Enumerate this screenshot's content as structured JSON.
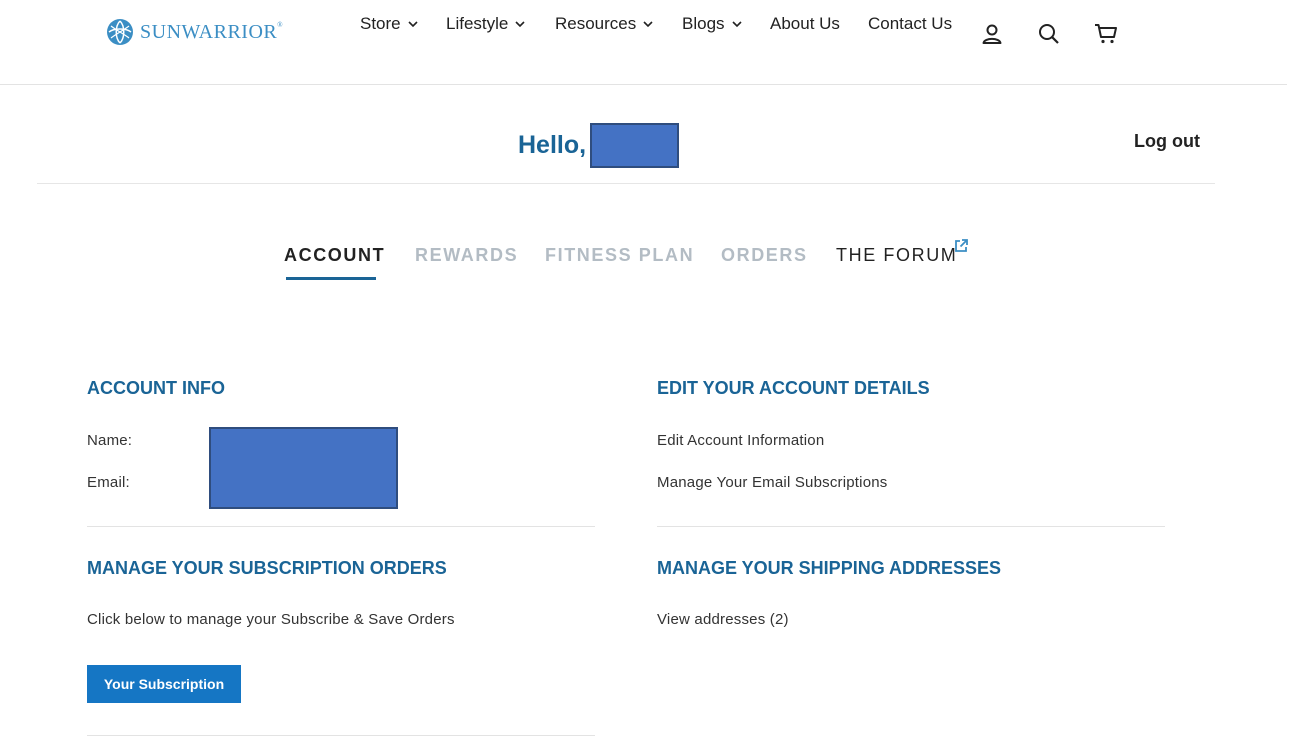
{
  "header": {
    "logo_text": "SUNWARRIOR",
    "logo_mark": "®",
    "nav": {
      "store": "Store",
      "lifestyle": "Lifestyle",
      "resources": "Resources",
      "blogs": "Blogs",
      "about": "About Us",
      "contact": "Contact Us"
    },
    "icons": [
      "user-icon",
      "search-icon",
      "cart-icon"
    ]
  },
  "greeting": {
    "hello": "Hello,",
    "logout": "Log out"
  },
  "tabs": {
    "account": "ACCOUNT",
    "rewards": "REWARDS",
    "fitness": "FITNESS PLAN",
    "orders": "ORDERS",
    "forum": "THE FORUM"
  },
  "account_info": {
    "title": "ACCOUNT INFO",
    "name_label": "Name:",
    "email_label": "Email:"
  },
  "edit_details": {
    "title": "EDIT YOUR ACCOUNT DETAILS",
    "edit_info": "Edit Account Information",
    "email_subs": "Manage Your Email Subscriptions"
  },
  "subscriptions": {
    "title": "MANAGE YOUR SUBSCRIPTION ORDERS",
    "desc": "Click below to manage your Subscribe & Save Orders",
    "button": "Your Subscription"
  },
  "shipping": {
    "title": "MANAGE YOUR SHIPPING ADDRESSES",
    "view": "View addresses (2)"
  },
  "colors": {
    "accent": "#1a6496",
    "button": "#1576c4",
    "redaction": "#4472c4",
    "inactive_tab": "#b3bcc4"
  }
}
